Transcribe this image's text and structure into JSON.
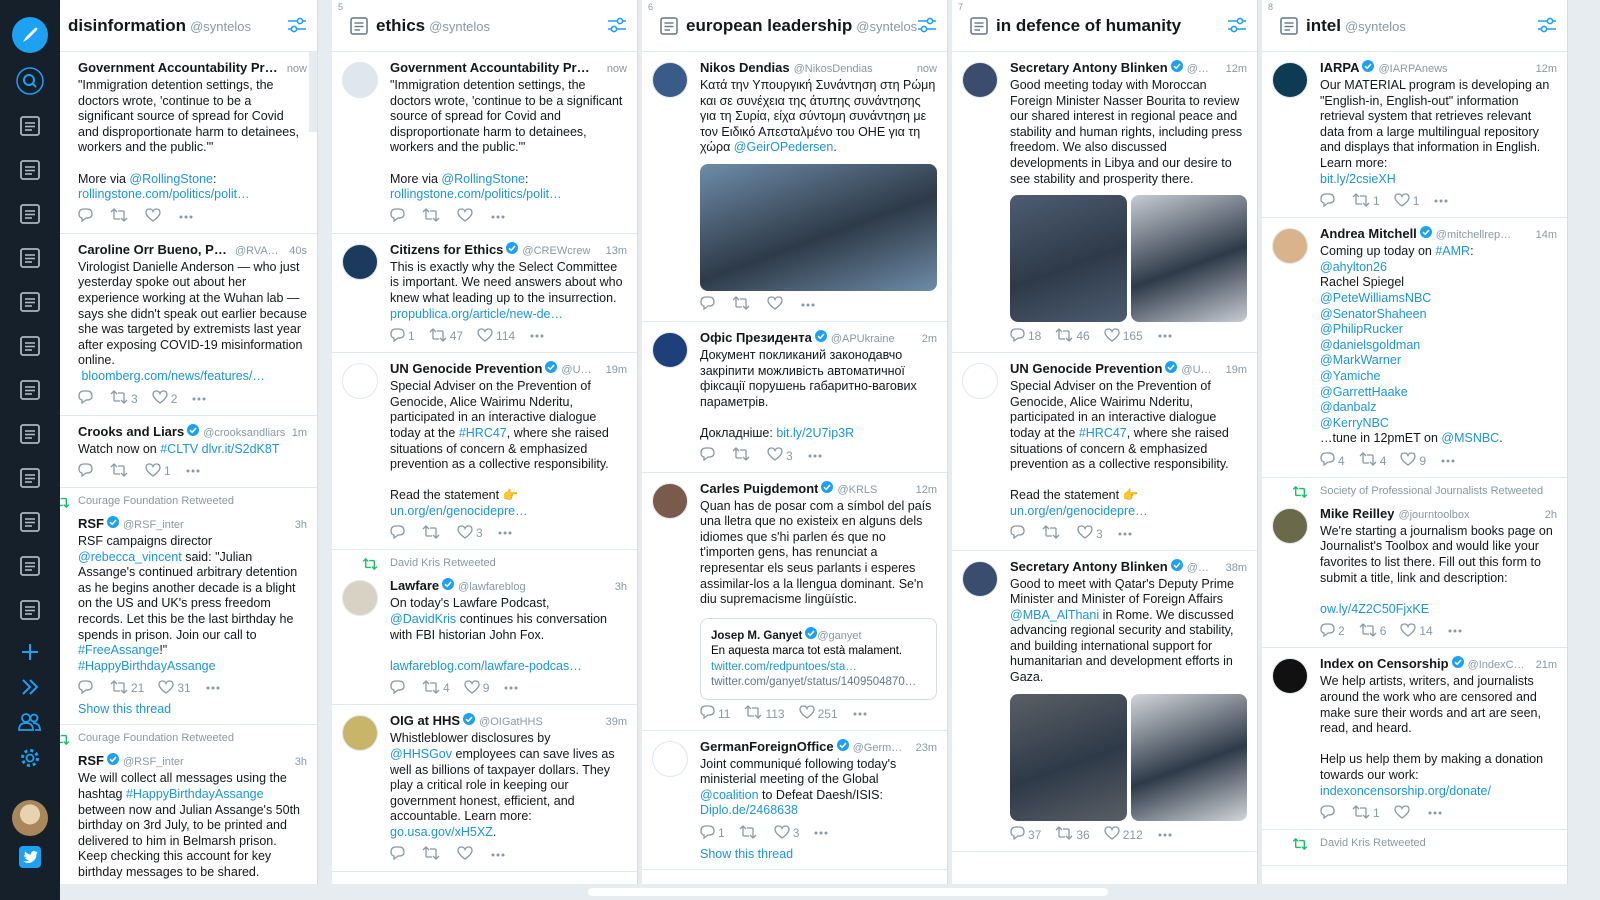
{
  "app": {
    "name": "TweetDeck"
  },
  "nav": {
    "items": [
      "compose-icon",
      "search-icon",
      "column-icon",
      "column-icon",
      "column-icon",
      "column-icon",
      "column-icon",
      "column-icon",
      "column-icon",
      "column-icon",
      "column-icon",
      "column-icon",
      "column-icon",
      "column-icon",
      "add-column-icon",
      "expand-icon",
      "accounts-icon",
      "settings-icon",
      "avatar",
      "twitter-logo-icon"
    ],
    "accent": "#1da1f2",
    "background": "#15202b"
  },
  "columns": [
    {
      "num": "",
      "title": "disinformation",
      "handle": "@syntelos",
      "tweets": [
        {
          "name": "Government Accountability Pr…",
          "handle": "",
          "time": "now",
          "avatar": "#ffffff",
          "text_parts": [
            {
              "t": "\"Immigration detention settings, the doctors wrote, 'continue to be a significant source of spread for Covid and disproportionate harm to detainees, workers and the public.'\"\n\nMore via "
            },
            {
              "t": "@RollingStone",
              "l": 1
            },
            {
              "t": ":\n"
            },
            {
              "t": "rollingstone.com/politics/polit…",
              "l": 1
            }
          ],
          "actions": [
            "",
            "",
            ""
          ]
        },
        {
          "name": "Caroline Orr Bueno, Ph.D",
          "handle": "@RVAw…",
          "time": "40s",
          "avatar": "#8a4b3c",
          "text_parts": [
            {
              "t": "Virologist Danielle Anderson — who just yesterday spoke out about her experience working at the Wuhan lab — says she didn't speak out earlier because she was targeted by extremists last year after exposing COVID-19 misinformation online.\n "
            },
            {
              "t": "bloomberg.com/news/features/…",
              "l": 1
            }
          ],
          "actions": [
            "",
            "3",
            "2"
          ]
        },
        {
          "name": "Crooks and Liars",
          "verified": 1,
          "handle": "@crooksandliars",
          "time": "1m",
          "avatar": "#b72a2a",
          "text_parts": [
            {
              "t": "Watch now on "
            },
            {
              "t": "#CLTV dlvr.it/S2dK8T",
              "l": 1
            }
          ],
          "actions": [
            "",
            "",
            "1"
          ]
        },
        {
          "rt": "Courage Foundation Retweeted",
          "name": "RSF",
          "verified": 1,
          "handle": "@RSF_inter",
          "time": "3h",
          "avatar": "#ffffff",
          "text_parts": [
            {
              "t": "RSF campaigns director\n"
            },
            {
              "t": "@rebecca_vincent",
              "l": 1
            },
            {
              "t": " said: \"Julian Assange's continued arbitrary detention as he begins another decade is a blight on the US and UK's press freedom records. Let this be the last birthday he spends in prison. Join our call to "
            },
            {
              "t": "#FreeAssange",
              "l": 1
            },
            {
              "t": "!\"\n"
            },
            {
              "t": "#HappyBirthdayAssange",
              "l": 1
            }
          ],
          "actions": [
            "",
            "21",
            "31"
          ],
          "thread": "Show this thread"
        },
        {
          "rt": "Courage Foundation Retweeted",
          "name": "RSF",
          "verified": 1,
          "handle": "@RSF_inter",
          "time": "3h",
          "avatar": "#ffffff",
          "text_parts": [
            {
              "t": "We will collect all messages using the hashtag "
            },
            {
              "t": "#HappyBirthdayAssange",
              "l": 1
            },
            {
              "t": " between now and Julian Assange's 50th birthday on 3rd July, to be printed and delivered to him in Belmarsh prison. Keep checking this account for key birthday messages to be shared."
            }
          ],
          "actions": [
            "",
            "",
            ""
          ]
        }
      ]
    },
    {
      "num": "5",
      "title": "ethics",
      "handle": "@syntelos",
      "tweets": [
        {
          "name": "Government Accountability Pr…",
          "handle": "",
          "time": "now",
          "avatar": "#dfe6ee",
          "text_parts": [
            {
              "t": "\"Immigration detention settings, the doctors wrote, 'continue to be a significant source of spread for Covid and disproportionate harm to detainees, workers and the public.'\"\n\nMore via "
            },
            {
              "t": "@RollingStone",
              "l": 1
            },
            {
              "t": ":\n"
            },
            {
              "t": "rollingstone.com/politics/polit…",
              "l": 1
            }
          ],
          "actions": [
            "",
            "",
            ""
          ]
        },
        {
          "name": "Citizens for Ethics",
          "verified": 1,
          "handle": "@CREWcrew",
          "time": "13m",
          "avatar": "#1c3a5e",
          "text_parts": [
            {
              "t": "This is exactly why the Select Committee is important. We need answers about who knew what leading up to the insurrection.\n"
            },
            {
              "t": "propublica.org/article/new-de…",
              "l": 1
            }
          ],
          "actions": [
            "1",
            "47",
            "114"
          ]
        },
        {
          "name": "UN Genocide Prevention",
          "verified": 1,
          "handle": "@U…",
          "time": "19m",
          "avatar": "#ffffff",
          "text_parts": [
            {
              "t": "Special Adviser on the Prevention of Genocide, Alice Wairimu Nderitu, participated in an interactive dialogue today at the "
            },
            {
              "t": "#HRC47",
              "l": 1
            },
            {
              "t": ", where she raised situations of concern & emphasized prevention as a collective responsibility.\n\nRead the statement 👉\n"
            },
            {
              "t": "un.org/en/genocidepre…",
              "l": 1
            }
          ],
          "actions": [
            "",
            "",
            "3"
          ]
        },
        {
          "rt": "David Kris Retweeted",
          "name": "Lawfare",
          "verified": 1,
          "handle": "@lawfareblog",
          "time": "3h",
          "avatar": "#d8d2c4",
          "text_parts": [
            {
              "t": "On today's Lawfare Podcast,\n"
            },
            {
              "t": "@DavidKris",
              "l": 1
            },
            {
              "t": " continues his conversation with FBI historian John Fox.\n\n"
            },
            {
              "t": "lawfareblog.com/lawfare-podcas…",
              "l": 1
            }
          ],
          "actions": [
            "",
            "4",
            "9"
          ]
        },
        {
          "name": "OIG at HHS",
          "verified": 1,
          "handle": "@OIGatHHS",
          "time": "39m",
          "avatar": "#c9b56a",
          "text_parts": [
            {
              "t": "Whistleblower disclosures by\n"
            },
            {
              "t": "@HHSGov",
              "l": 1
            },
            {
              "t": " employees can save lives as well as billions of taxpayer dollars. They play a critical role in keeping our government honest, efficient, and accountable. Learn more:\n"
            },
            {
              "t": "go.usa.gov/xH5XZ",
              "l": 1
            },
            {
              "t": "."
            }
          ],
          "actions": [
            "",
            "",
            ""
          ]
        }
      ]
    },
    {
      "num": "6",
      "title": "european leadership",
      "handle": "@syntelos",
      "tweets": [
        {
          "name": "Nikos Dendias",
          "handle": "@NikosDendias",
          "time": "now",
          "avatar": "#3a5a8a",
          "text_parts": [
            {
              "t": "Κατά την Υπουργική Συνάντηση στη Ρώμη και σε συνέχεια της άτυπης συνάντησης για τη Συρία, είχα σύντομη συνάντηση με τον Ειδικό Απεσταλμένο του ΟΗΕ για τη χώρα "
            },
            {
              "t": "@GeirOPedersen",
              "l": 1
            },
            {
              "t": "."
            }
          ],
          "media": [
            "#6e8ca8"
          ],
          "actions": [
            "",
            "",
            ""
          ]
        },
        {
          "name": "Офіс Президента",
          "verified": 1,
          "handle": "@APUkraine",
          "time": "2m",
          "avatar": "#1f3f7a",
          "text_parts": [
            {
              "t": "Документ покликаний законодавчо закріпити можливість автоматичної фіксації порушень габаритно-вагових параметрів.\n\nДокладніше: "
            },
            {
              "t": "bit.ly/2U7ip3R",
              "l": 1
            }
          ],
          "actions": [
            "",
            "",
            "3"
          ]
        },
        {
          "name": "Carles Puigdemont",
          "verified": 1,
          "handle": "@KRLS",
          "time": "12m",
          "avatar": "#7a5a4a",
          "text_parts": [
            {
              "t": "Quan has de posar com a símbol del país una lletra que no existeix en alguns dels idiomes que s'hi parlen és que no t'importen gens, has renunciat a representar els seus parlants i esperes assimilar-los a la llengua dominant. Se'n diu supremacisme lingüístic."
            }
          ],
          "quote": {
            "name": "Josep M. Ganyet",
            "handle": "@ganyet",
            "text": "En aquesta marca tot està malament.",
            "link1": "twitter.com/redpuntoes/sta…",
            "link2": "twitter.com/ganyet/status/1409504870…"
          },
          "actions": [
            "11",
            "113",
            "251"
          ]
        },
        {
          "name": "GermanForeignOffice",
          "verified": 1,
          "handle": "@Germ…",
          "time": "23m",
          "avatar": "#ffffff",
          "text_parts": [
            {
              "t": "Joint communiqué following today's ministerial meeting of the Global\n"
            },
            {
              "t": "@coalition",
              "l": 1
            },
            {
              "t": " to Defeat Daesh/ISIS:\n"
            },
            {
              "t": "Diplo.de/2468638",
              "l": 1
            }
          ],
          "actions": [
            "1",
            "",
            "3"
          ],
          "thread": "Show this thread"
        }
      ]
    },
    {
      "num": "7",
      "title": "in defence of humanity",
      "handle": "",
      "tweets": [
        {
          "name": "Secretary Antony Blinken",
          "verified": 1,
          "handle": "@…",
          "time": "12m",
          "avatar": "#3a4d6e",
          "text_parts": [
            {
              "t": "Good meeting today with Moroccan Foreign Minister Nasser Bourita to review our shared interest in regional peace and stability and human rights, including press freedom. We also discussed developments in Libya and our desire to see stability and prosperity there."
            }
          ],
          "media": [
            "#4e5c72",
            "#c7ccd4"
          ],
          "actions": [
            "18",
            "46",
            "165"
          ]
        },
        {
          "name": "UN Genocide Prevention",
          "verified": 1,
          "handle": "@U…",
          "time": "19m",
          "avatar": "#ffffff",
          "text_parts": [
            {
              "t": "Special Adviser on the Prevention of Genocide, Alice Wairimu Nderitu, participated in an interactive dialogue today at the "
            },
            {
              "t": "#HRC47",
              "l": 1
            },
            {
              "t": ", where she raised situations of concern & emphasized prevention as a collective responsibility.\n\nRead the statement 👉\n"
            },
            {
              "t": "un.org/en/genocidepre…",
              "l": 1
            }
          ],
          "actions": [
            "",
            "",
            "3"
          ]
        },
        {
          "name": "Secretary Antony Blinken",
          "verified": 1,
          "handle": "@…",
          "time": "38m",
          "avatar": "#3a4d6e",
          "text_parts": [
            {
              "t": "Good to meet with Qatar's Deputy Prime Minister and Minister of Foreign Affairs "
            },
            {
              "t": "@MBA_AlThani",
              "l": 1
            },
            {
              "t": " in Rome. We discussed advancing regional security and stability, and building international support for humanitarian and development efforts in Gaza."
            }
          ],
          "media": [
            "#5a5f66",
            "#d2d6db"
          ],
          "actions": [
            "37",
            "36",
            "212"
          ]
        }
      ]
    },
    {
      "num": "8",
      "title": "intel",
      "handle": "@syntelos",
      "tweets": [
        {
          "name": "IARPA",
          "verified": 1,
          "handle": "@IARPAnews",
          "time": "12m",
          "avatar": "#0e3b54",
          "text_parts": [
            {
              "t": "Our MATERIAL program is developing an \"English-in, English-out\" information retrieval system that retrieves relevant data from a large multilingual repository and displays that information in English. Learn more:\n"
            },
            {
              "t": "bit.ly/2csieXH",
              "l": 1
            }
          ],
          "actions": [
            "",
            "1",
            "1"
          ]
        },
        {
          "name": "Andrea Mitchell",
          "verified": 1,
          "handle": "@mitchellrep…",
          "time": "14m",
          "avatar": "#d9b38c",
          "text_parts": [
            {
              "t": "Coming up today on "
            },
            {
              "t": "#AMR",
              "l": 1
            },
            {
              "t": ":\n"
            },
            {
              "t": "@ahylton26",
              "l": 1
            },
            {
              "t": "\nRachel Spiegel\n"
            },
            {
              "t": "@PeteWilliamsNBC\n@SenatorShaheen\n@PhilipRucker\n@danielsgoldman\n@MarkWarner\n@Yamiche\n@GarrettHaake\n@danbalz\n@KerryNBC",
              "l": 1
            },
            {
              "t": "\n…tune in 12pmET on "
            },
            {
              "t": "@MSNBC",
              "l": 1
            },
            {
              "t": "."
            }
          ],
          "actions": [
            "4",
            "4",
            "9"
          ]
        },
        {
          "rt": "Society of Professional Journalists Retweeted",
          "name": "Mike Reilley",
          "handle": "@journtoolbox",
          "time": "2h",
          "avatar": "#6a6a4a",
          "text_parts": [
            {
              "t": "We're starting a journalism books page on Journalist's Toolbox and would like your favorites to list there. Fill out this form to submit a title, link and description:\n\n"
            },
            {
              "t": "ow.ly/4Z2C50FjxKE",
              "l": 1
            }
          ],
          "actions": [
            "2",
            "6",
            "14"
          ]
        },
        {
          "name": "Index on Censorship",
          "verified": 1,
          "handle": "@IndexC…",
          "time": "21m",
          "avatar": "#111111",
          "text_parts": [
            {
              "t": "We help artists, writers, and journalists around the work who are censored and make sure their words and art are seen, read, and heard.\n\nHelp us help them by making a donation towards our work:\n"
            },
            {
              "t": "indexoncensorship.org/donate/",
              "l": 1
            }
          ],
          "actions": [
            "",
            "1",
            ""
          ]
        },
        {
          "rt": "David Kris Retweeted",
          "name": "",
          "handle": "",
          "time": "",
          "avatar": "#ffffff",
          "text_parts": [],
          "actions": []
        }
      ]
    }
  ]
}
